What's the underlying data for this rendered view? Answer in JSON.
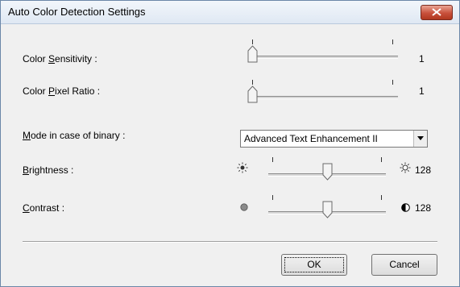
{
  "window": {
    "title": "Auto Color Detection Settings"
  },
  "sensitivity": {
    "label_pre": "Color ",
    "label_key": "S",
    "label_post": "ensitivity :",
    "value": "1",
    "level": 0
  },
  "pixel_ratio": {
    "label_pre": "Color ",
    "label_key": "P",
    "label_post": "ixel Ratio :",
    "value": "1",
    "level": 0
  },
  "mode": {
    "label_key": "M",
    "label_post": "ode in case of binary :",
    "selected": "Advanced Text Enhancement II"
  },
  "brightness": {
    "label_key": "B",
    "label_post": "rightness :",
    "value": "128",
    "level": 0.5,
    "low_icon": "sun-dim-icon",
    "high_icon": "sun-bright-icon"
  },
  "contrast": {
    "label_key": "C",
    "label_post": "ontrast :",
    "value": "128",
    "level": 0.5,
    "low_icon": "circle-low-contrast-icon",
    "high_icon": "circle-high-contrast-icon"
  },
  "buttons": {
    "ok": "OK",
    "cancel": "Cancel"
  },
  "colors": {
    "close_button": "#c8503b"
  }
}
